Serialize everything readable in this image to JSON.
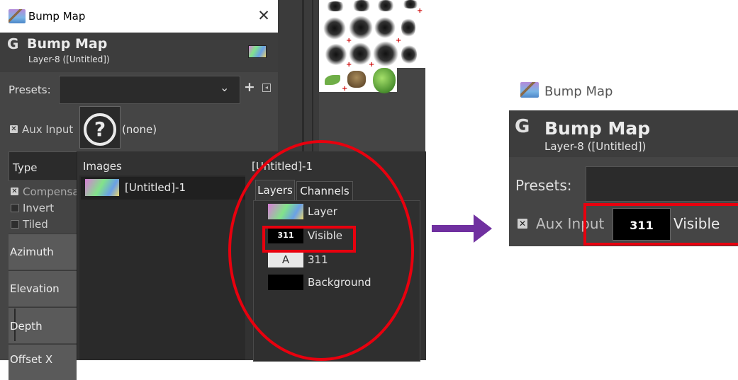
{
  "left": {
    "title": "Bump Map",
    "close_glyph": "✕",
    "header": {
      "op_title": "Bump Map",
      "layer": "Layer-8 ([Untitled])"
    },
    "presets_label": "Presets:",
    "presets_add": "+",
    "aux_input_label": "Aux Input",
    "aux_none": "(none)",
    "type_label": "Type",
    "compensate_label": "Compensa",
    "invert_label": "Invert",
    "tiled_label": "Tiled",
    "params": {
      "azimuth": "Azimuth",
      "elevation": "Elevation",
      "depth": "Depth",
      "offset": "Offset X"
    },
    "popup": {
      "images_label": "Images",
      "image_name": "[Untitled]-1",
      "right_title": "[Untitled]-1",
      "tabs": {
        "layers": "Layers",
        "channels": "Channels"
      },
      "layers": [
        {
          "name": "Layer"
        },
        {
          "name": "Visible",
          "thumb_text": "311"
        },
        {
          "name": "311",
          "thumb_text": "A"
        },
        {
          "name": "Background"
        }
      ]
    }
  },
  "right": {
    "title": "Bump Map",
    "header": {
      "op_title": "Bump Map",
      "layer": "Layer-8 ([Untitled])"
    },
    "presets_label": "Presets:",
    "aux_input_label": "Aux Input",
    "visible_thumb_text": "311",
    "visible_label": "Visible"
  },
  "colors": {
    "annotation_red": "#e8000e",
    "arrow_purple": "#7030a0",
    "dialog_bg": "#454545"
  },
  "icons": {
    "app": "gimp-app-icon",
    "logo": "gimp-g-logo",
    "help": "question-circle-icon",
    "text_layer": "text-layer-icon"
  }
}
